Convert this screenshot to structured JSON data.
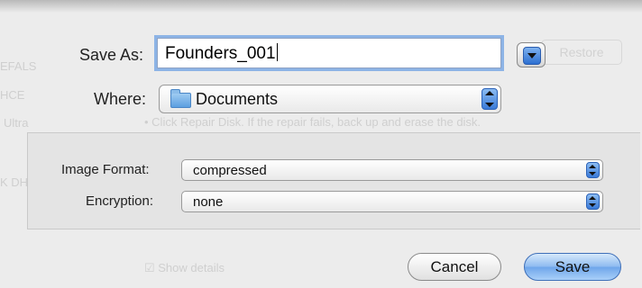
{
  "dialog": {
    "save_as_label": "Save As:",
    "filename_value": "Founders_001",
    "where_label": "Where:",
    "where_value": "Documents",
    "expand_icon": "disclosure-triangle-icon",
    "folder_icon": "folder-icon"
  },
  "options": {
    "image_format_label": "Image Format:",
    "image_format_value": "compressed",
    "encryption_label": "Encryption:",
    "encryption_value": "none"
  },
  "buttons": {
    "cancel_label": "Cancel",
    "save_label": "Save"
  },
  "colors": {
    "accent": "#5e9ae6",
    "focus_ring": "#8db4e6",
    "background": "#ececec"
  }
}
